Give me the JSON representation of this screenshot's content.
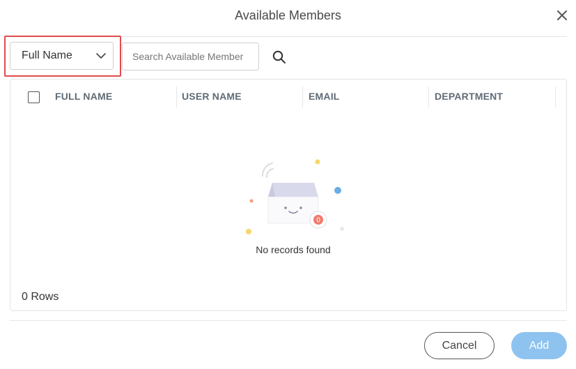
{
  "dialog": {
    "title": "Available Members"
  },
  "filter": {
    "selected": "Full Name"
  },
  "search": {
    "placeholder": "Search Available Member",
    "value": ""
  },
  "grid": {
    "columns": [
      "FULL NAME",
      "USER NAME",
      "EMAIL",
      "DEPARTMENT"
    ],
    "empty_message": "No records found",
    "badge_count": "0",
    "rows_count": "0 Rows"
  },
  "footer": {
    "cancel_label": "Cancel",
    "add_label": "Add"
  },
  "colors": {
    "highlight": "#e14b4b",
    "primary_disabled": "#8ec3ef",
    "header_text": "#5f6b76"
  },
  "icons": {
    "close": "close-icon",
    "dropdown": "chevron-down-icon",
    "search": "search-icon",
    "empty": "empty-box-icon"
  }
}
